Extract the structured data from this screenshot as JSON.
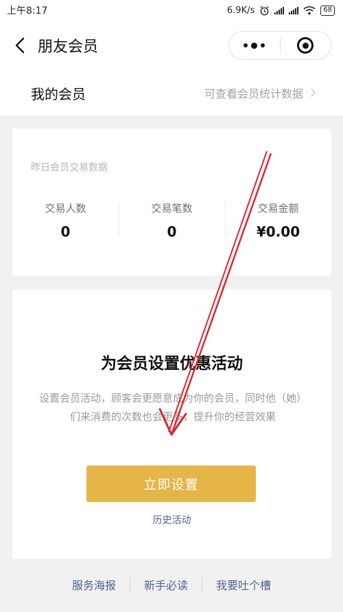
{
  "status_bar": {
    "time": "上午8:17",
    "network_speed": "6.9K/s",
    "battery": "68",
    "icons": [
      "alarm-icon",
      "signal-icon",
      "signal-icon",
      "wifi-icon",
      "battery-icon"
    ]
  },
  "nav": {
    "title": "朋友会员",
    "back_icon": "chevron-left-icon",
    "menu_icon": "more-dots-icon",
    "close_icon": "target-circle-icon"
  },
  "section": {
    "title": "我的会员",
    "link_label": "可查看会员统计数据"
  },
  "stats": {
    "caption": "昨日会员交易数据",
    "items": [
      {
        "label": "交易人数",
        "value": "0"
      },
      {
        "label": "交易笔数",
        "value": "0"
      },
      {
        "label": "交易金额",
        "value": "¥0.00"
      }
    ]
  },
  "promo": {
    "title": "为会员设置优惠活动",
    "description": "设置会员活动，顾客会更愿意成为你的会员，同时他（她）们来消费的次数也会更多，提升你的经营效果",
    "cta_label": "立即设置",
    "history_link": "历史活动"
  },
  "footer": {
    "links": [
      "服务海报",
      "新手必读",
      "我要吐个槽"
    ]
  },
  "colors": {
    "accent": "#e5b547",
    "link": "#4d6491",
    "background": "#f1f1f1",
    "annotation_arrow": "#d9272e"
  }
}
